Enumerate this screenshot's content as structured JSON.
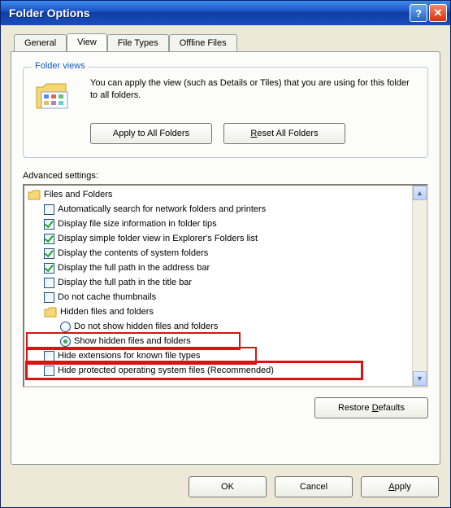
{
  "window": {
    "title": "Folder Options"
  },
  "tabs": {
    "general": "General",
    "view": "View",
    "file_types": "File Types",
    "offline_files": "Offline Files"
  },
  "folder_views": {
    "legend": "Folder views",
    "desc": "You can apply the view (such as Details or Tiles) that you are using for this folder to all folders.",
    "apply_btn": "Apply to All Folders",
    "reset_btn_pre": "R",
    "reset_btn_rest": "eset All Folders"
  },
  "advanced": {
    "label": "Advanced settings:",
    "root": "Files and Folders",
    "items": {
      "auto_search": "Automatically search for network folders and printers",
      "file_size": "Display file size information in folder tips",
      "simple_view": "Display simple folder view in Explorer's Folders list",
      "sys_folders": "Display the contents of system folders",
      "addr_bar": "Display the full path in the address bar",
      "title_bar": "Display the full path in the title bar",
      "no_thumbs": "Do not cache thumbnails",
      "hidden_group": "Hidden files and folders",
      "hidden_no": "Do not show hidden files and folders",
      "hidden_yes": "Show hidden files and folders",
      "hide_ext": "Hide extensions for known file types",
      "hide_os": "Hide protected operating system files (Recommended)"
    },
    "restore_btn_pre": "D",
    "restore_btn_text_before": "Restore ",
    "restore_btn_text_after": "efaults"
  },
  "dialog_buttons": {
    "ok": "OK",
    "cancel": "Cancel",
    "apply_pre": "A",
    "apply_rest": "pply"
  }
}
